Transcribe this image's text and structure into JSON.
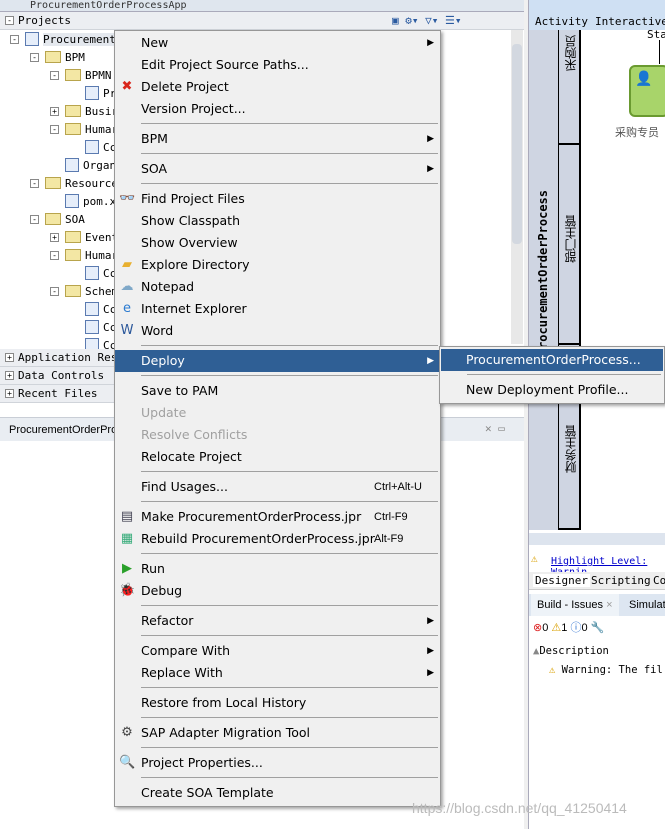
{
  "window": {
    "title": "ProcurementOrderProcessApp"
  },
  "panels": {
    "projects": "Projects",
    "application_resources": "Application Reso",
    "data_controls": "Data Controls",
    "recent_files": "Recent Files"
  },
  "tree": [
    {
      "label": "ProcurementO",
      "depth": 0,
      "exp": "-",
      "icon": "project"
    },
    {
      "label": "BPM",
      "depth": 1,
      "exp": "-",
      "icon": "folder"
    },
    {
      "label": "BPMN",
      "depth": 2,
      "exp": "-",
      "icon": "folder"
    },
    {
      "label": "Pr",
      "depth": 3,
      "exp": "",
      "icon": "file"
    },
    {
      "label": "Busir",
      "depth": 2,
      "exp": "+",
      "icon": "folder"
    },
    {
      "label": "Humar",
      "depth": 2,
      "exp": "-",
      "icon": "folder"
    },
    {
      "label": "Cc",
      "depth": 3,
      "exp": "",
      "icon": "file"
    },
    {
      "label": "Organ",
      "depth": 2,
      "exp": "",
      "icon": "file"
    },
    {
      "label": "Resource",
      "depth": 1,
      "exp": "-",
      "icon": "folder"
    },
    {
      "label": "pom.x",
      "depth": 2,
      "exp": "",
      "icon": "file"
    },
    {
      "label": "SOA",
      "depth": 1,
      "exp": "-",
      "icon": "folder"
    },
    {
      "label": "Event",
      "depth": 2,
      "exp": "+",
      "icon": "folder"
    },
    {
      "label": "Humar",
      "depth": 2,
      "exp": "-",
      "icon": "folder"
    },
    {
      "label": "Cc",
      "depth": 3,
      "exp": "",
      "icon": "file"
    },
    {
      "label": "Schem",
      "depth": 2,
      "exp": "-",
      "icon": "folder"
    },
    {
      "label": "Cc",
      "depth": 3,
      "exp": "",
      "icon": "file"
    },
    {
      "label": "Cc",
      "depth": 3,
      "exp": "",
      "icon": "file"
    },
    {
      "label": "Cc",
      "depth": 3,
      "exp": "",
      "icon": "file"
    }
  ],
  "editor_tab": "ProcurementOrderPro",
  "context_menu": [
    {
      "label": "New",
      "submenu": true
    },
    {
      "label": "Edit Project Source Paths..."
    },
    {
      "label": "Delete Project",
      "icon": "delete-icon",
      "glyph": "✖",
      "color": "#d9261c"
    },
    {
      "label": "Version Project..."
    },
    {
      "sep": true
    },
    {
      "label": "BPM",
      "submenu": true
    },
    {
      "sep": true
    },
    {
      "label": "SOA",
      "submenu": true
    },
    {
      "sep": true
    },
    {
      "label": "Find Project Files",
      "icon": "binoculars-icon",
      "glyph": "👓",
      "color": "#223"
    },
    {
      "label": "Show Classpath"
    },
    {
      "label": "Show Overview"
    },
    {
      "label": "Explore Directory",
      "icon": "folder-icon",
      "glyph": "▰",
      "color": "#e8b030"
    },
    {
      "label": "Notepad",
      "icon": "notepad-icon",
      "glyph": "☁",
      "color": "#7fa8c8"
    },
    {
      "label": "Internet Explorer",
      "icon": "internet-explorer-icon",
      "glyph": "e",
      "color": "#2a7ad0"
    },
    {
      "label": "Word",
      "icon": "word-icon",
      "glyph": "W",
      "color": "#2b579a"
    },
    {
      "sep": true
    },
    {
      "label": "Deploy",
      "submenu": true,
      "selected": true
    },
    {
      "sep": true
    },
    {
      "label": "Save to PAM"
    },
    {
      "label": "Update",
      "disabled": true
    },
    {
      "label": "Resolve Conflicts",
      "disabled": true
    },
    {
      "label": "Relocate Project"
    },
    {
      "sep": true
    },
    {
      "label": "Find Usages...",
      "shortcut": "Ctrl+Alt-U"
    },
    {
      "sep": true
    },
    {
      "label": "Make ProcurementOrderProcess.jpr",
      "shortcut": "Ctrl-F9",
      "icon": "make-icon",
      "glyph": "▤",
      "color": "#445"
    },
    {
      "label": "Rebuild ProcurementOrderProcess.jpr",
      "shortcut": "Alt-F9",
      "icon": "rebuild-icon",
      "glyph": "▦",
      "color": "#3a7"
    },
    {
      "sep": true
    },
    {
      "label": "Run",
      "icon": "run-icon",
      "glyph": "▶",
      "color": "#2aa02a"
    },
    {
      "label": "Debug",
      "icon": "debug-icon",
      "glyph": "🐞",
      "color": "#c33"
    },
    {
      "sep": true
    },
    {
      "label": "Refactor",
      "submenu": true
    },
    {
      "sep": true
    },
    {
      "label": "Compare With",
      "submenu": true
    },
    {
      "label": "Replace With",
      "submenu": true
    },
    {
      "sep": true
    },
    {
      "label": "Restore from Local History"
    },
    {
      "sep": true
    },
    {
      "label": "SAP Adapter Migration Tool",
      "icon": "sap-adapter-icon",
      "glyph": "⚙",
      "color": "#444"
    },
    {
      "sep": true
    },
    {
      "label": "Project Properties...",
      "icon": "properties-icon",
      "glyph": "🔍",
      "color": "#2a5aa0"
    },
    {
      "sep": true
    },
    {
      "label": "Create SOA Template"
    }
  ],
  "deploy_submenu": [
    {
      "label": "ProcurementOrderProcess...",
      "selected": true
    },
    {
      "sep": true
    },
    {
      "label": "New Deployment Profile..."
    }
  ],
  "designer": {
    "palette": [
      "Activity",
      "Interactive"
    ],
    "pool": "ProcurementOrderProcess",
    "lanes": [
      "采购员",
      "部门主管",
      "财务主管"
    ],
    "start_label": "Sta",
    "task_label": "采购专员",
    "highlight": "Highlight Level: Warnin",
    "tabs": [
      "Designer",
      "Scripting",
      "Co"
    ]
  },
  "issues": {
    "tabs": [
      "Build - Issues",
      "Simulati"
    ],
    "errors": "0",
    "warnings": "1",
    "infos": "0",
    "column": "Description",
    "row": "Warning: The fil"
  },
  "watermark": "https://blog.csdn.net/qq_41250414"
}
